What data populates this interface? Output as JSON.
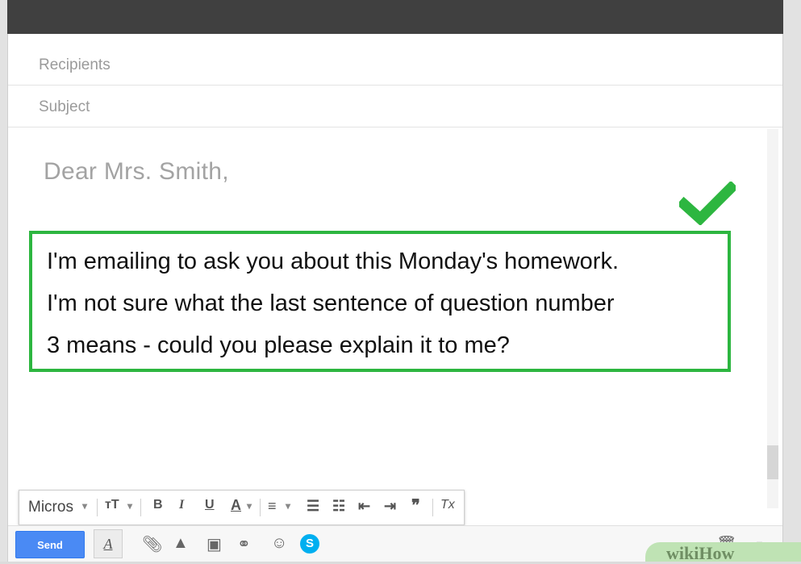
{
  "compose": {
    "recipients_placeholder": "Recipients",
    "subject_placeholder": "Subject",
    "greeting": "Dear Mrs. Smith,",
    "body_lines": [
      "I'm emailing to ask you about this Monday's homework.",
      "I'm not sure what the last sentence of question number",
      "3 means - could you please explain it to me?"
    ]
  },
  "format_toolbar": {
    "font_label": "Micros",
    "size_label": "тT",
    "bold": "B",
    "italic": "I",
    "underline": "U",
    "text_color": "A",
    "quote": "❞",
    "clear_format": "Tx"
  },
  "bottom_toolbar": {
    "send_label": "Send"
  },
  "colors": {
    "highlight_border": "#2db640",
    "send_button": "#4a8af4",
    "topbar": "#404040"
  },
  "watermark": "wikiHow"
}
